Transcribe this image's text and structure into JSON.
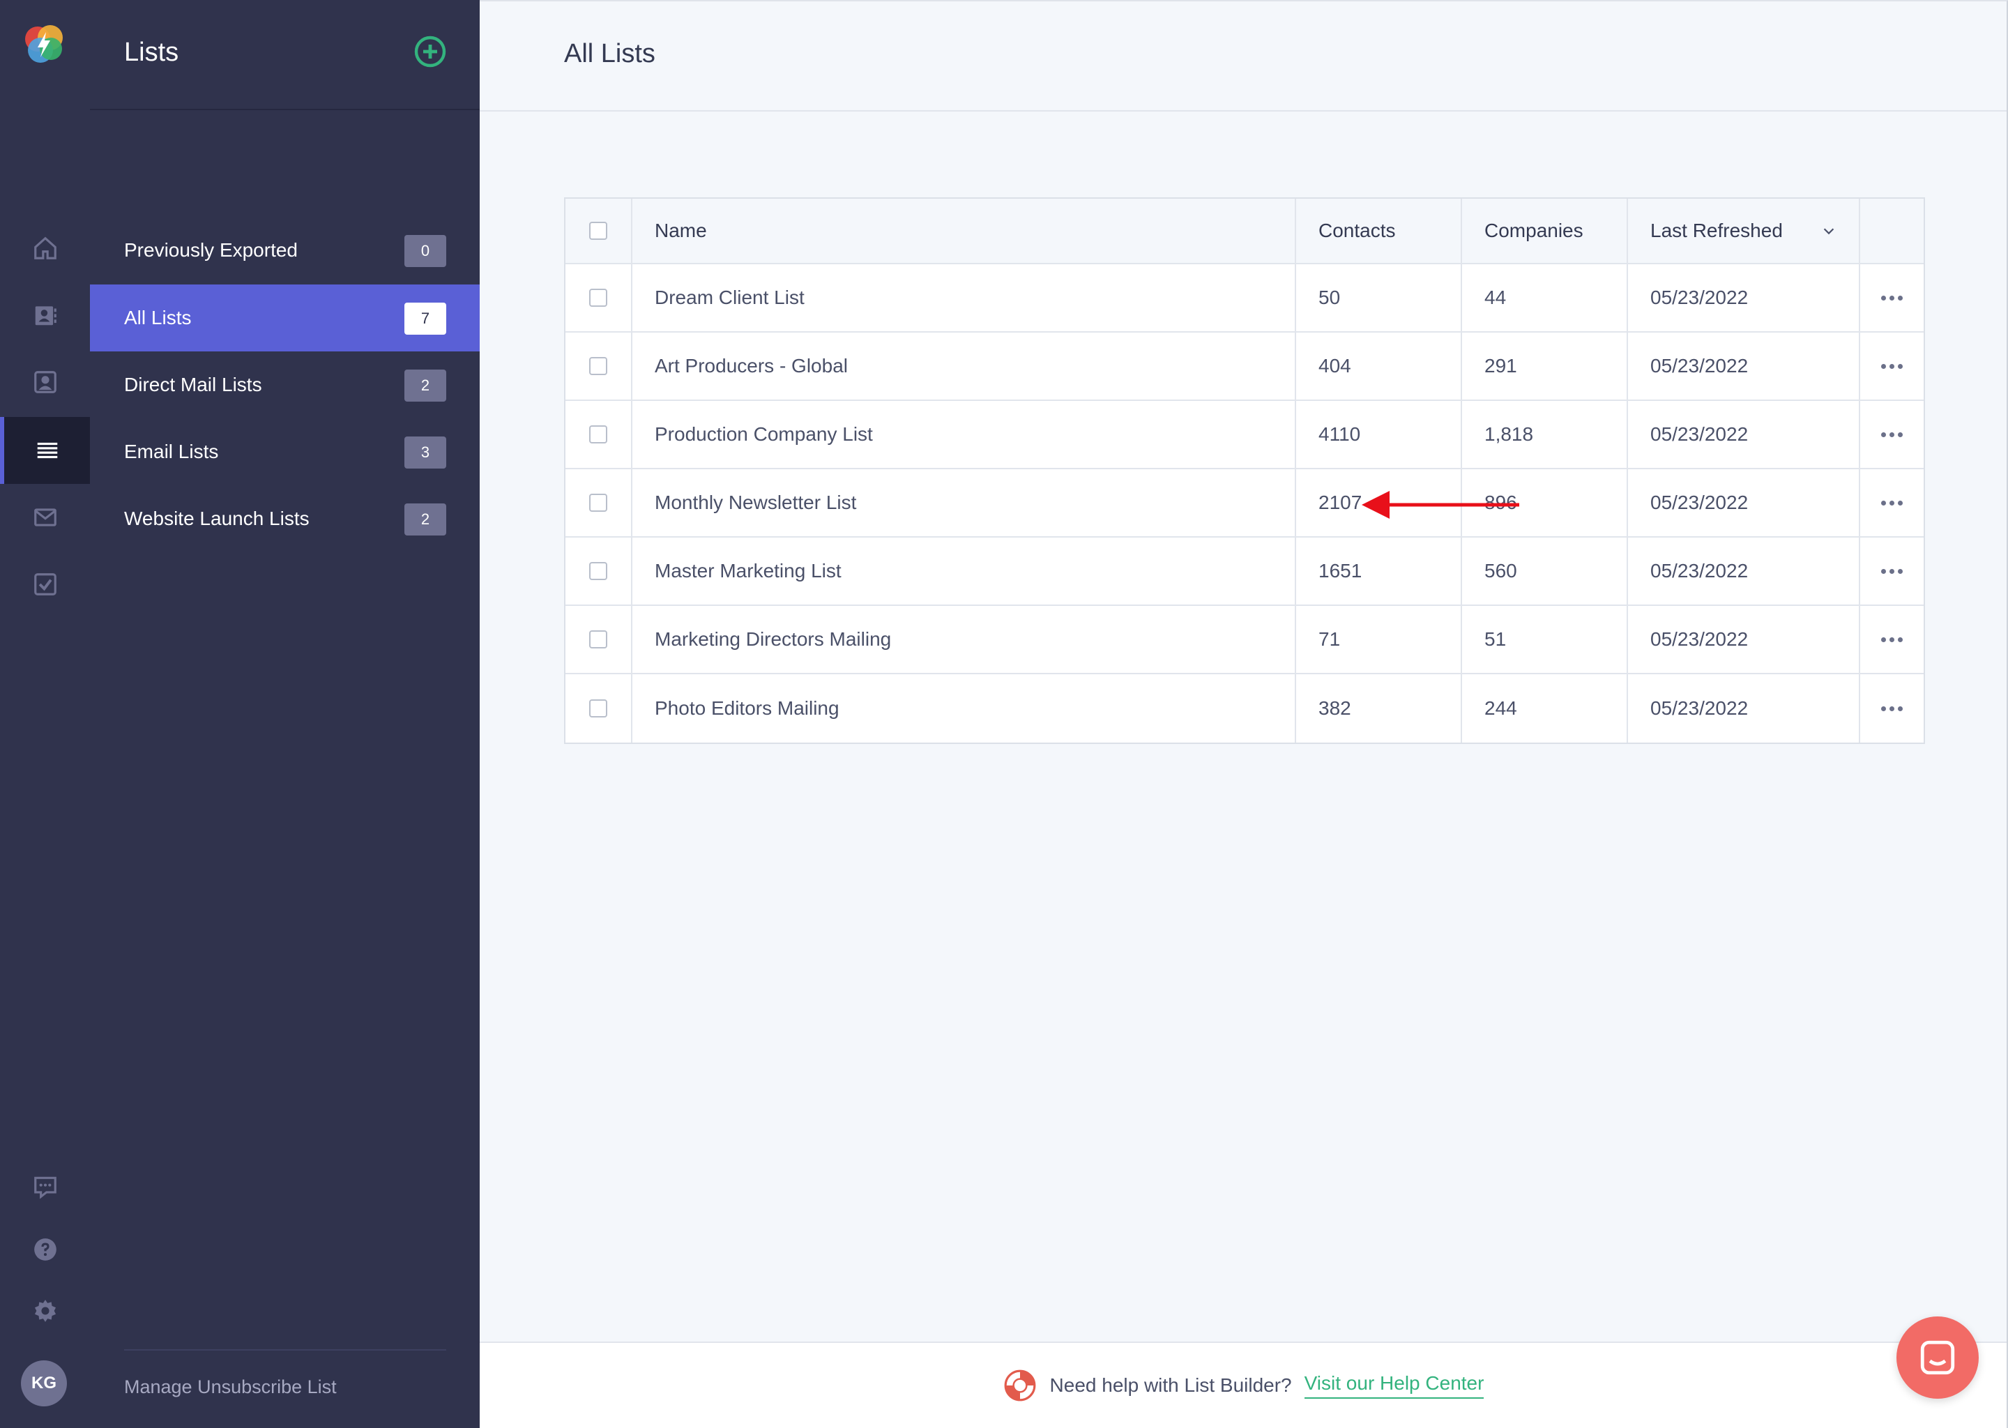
{
  "rail": {
    "avatar_initials": "KG",
    "items": [
      "home-icon",
      "contacts-card-icon",
      "person-icon",
      "lists-icon",
      "mail-icon",
      "tasks-check-icon"
    ],
    "bottom_items": [
      "feedback-icon",
      "help-icon",
      "gear-icon"
    ],
    "active_item": "lists-icon"
  },
  "sidebar": {
    "title": "Lists",
    "items": [
      {
        "label": "Previously Exported",
        "count": "0"
      },
      {
        "label": "All Lists",
        "count": "7",
        "active": true
      },
      {
        "label": "Direct Mail Lists",
        "count": "2"
      },
      {
        "label": "Email Lists",
        "count": "3"
      },
      {
        "label": "Website Launch Lists",
        "count": "2"
      }
    ],
    "manage_link": "Manage Unsubscribe List"
  },
  "main": {
    "title": "All Lists",
    "table": {
      "headers": {
        "name": "Name",
        "contacts": "Contacts",
        "companies": "Companies",
        "last_refreshed": "Last Refreshed"
      },
      "rows": [
        {
          "name": "Dream Client List",
          "contacts": "50",
          "companies": "44",
          "last_refreshed": "05/23/2022"
        },
        {
          "name": "Art Producers - Global",
          "contacts": "404",
          "companies": "291",
          "last_refreshed": "05/23/2022"
        },
        {
          "name": "Production Company List",
          "contacts": "4110",
          "companies": "1,818",
          "last_refreshed": "05/23/2022"
        },
        {
          "name": "Monthly Newsletter List",
          "contacts": "2107",
          "companies": "896",
          "last_refreshed": "05/23/2022"
        },
        {
          "name": "Master Marketing List",
          "contacts": "1651",
          "companies": "560",
          "last_refreshed": "05/23/2022"
        },
        {
          "name": "Marketing Directors Mailing",
          "contacts": "71",
          "companies": "51",
          "last_refreshed": "05/23/2022"
        },
        {
          "name": "Photo Editors Mailing",
          "contacts": "382",
          "companies": "244",
          "last_refreshed": "05/23/2022"
        }
      ]
    }
  },
  "footer": {
    "prompt": "Need help with List Builder?",
    "link": "Visit our Help Center"
  },
  "colors": {
    "sidebar_bg": "#30334d",
    "active_item": "#5a60d6",
    "accent_green": "#33b37e",
    "annotation_arrow": "#e8101a",
    "chat_button": "#f26b66"
  }
}
